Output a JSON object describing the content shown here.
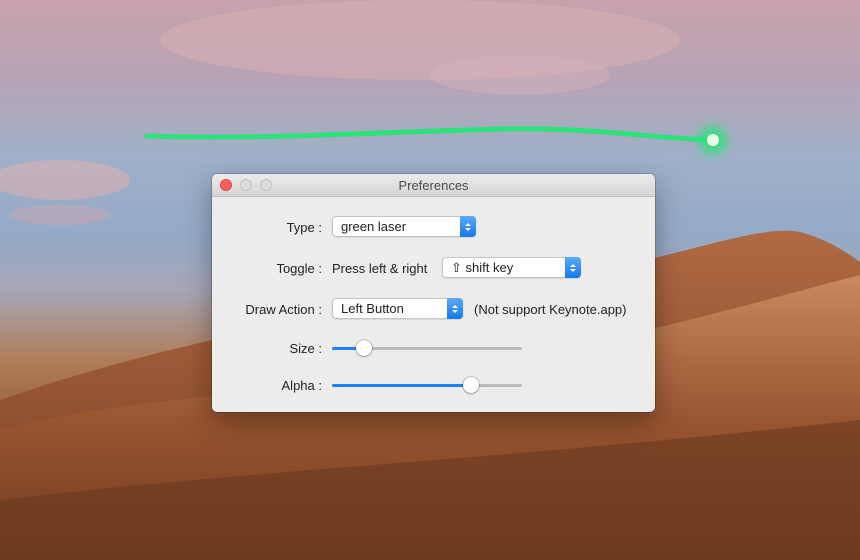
{
  "window": {
    "title": "Preferences"
  },
  "form": {
    "type_label": "Type :",
    "type_value": "green laser",
    "toggle_label": "Toggle :",
    "toggle_text": "Press left & right",
    "toggle_key_icon": "⇧",
    "toggle_key_value": "shift key",
    "draw_action_label": "Draw Action :",
    "draw_action_value": "Left Button",
    "draw_action_note": "(Not support Keynote.app)",
    "size_label": "Size :",
    "size_value": 0.17,
    "alpha_label": "Alpha :",
    "alpha_value": 0.73
  },
  "colors": {
    "laser": "#2ee27a",
    "accent": "#1a82f6",
    "close": "#fc605c"
  }
}
